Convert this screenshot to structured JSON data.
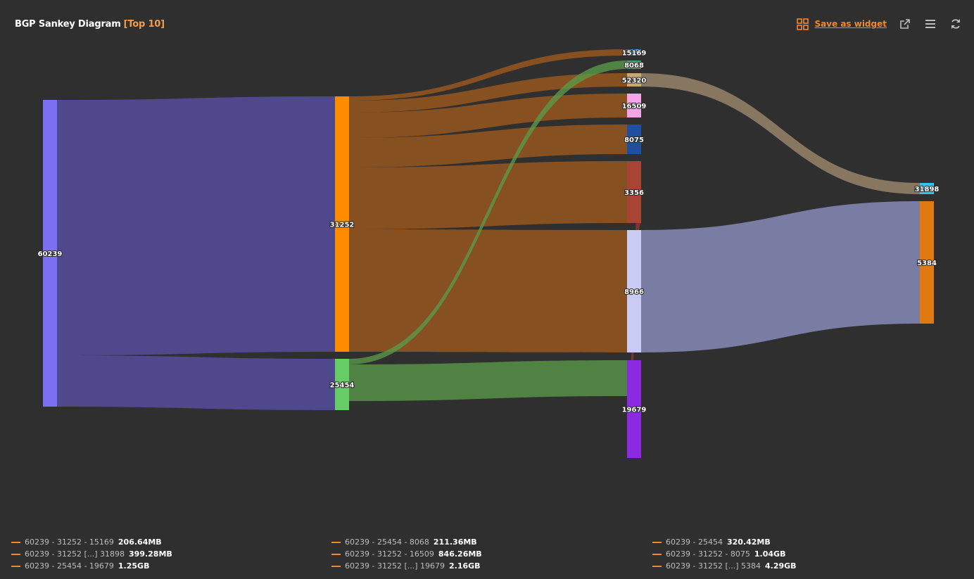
{
  "header": {
    "title": "BGP Sankey Diagram",
    "badge": "[Top 10]",
    "save_label": "Save as widget"
  },
  "colors": {
    "accent": "#f0892e",
    "background": "#2f2f2f"
  },
  "chart_data": {
    "type": "sankey",
    "title": "BGP Sankey Diagram",
    "nodes": [
      {
        "id": "60239",
        "color": "#7b6ff2"
      },
      {
        "id": "31252",
        "color": "#ff8c00"
      },
      {
        "id": "25454",
        "color": "#66cc66"
      },
      {
        "id": "15169",
        "color": "#5b9bd5"
      },
      {
        "id": "8068",
        "color": "#4d9f6a"
      },
      {
        "id": "52320",
        "color": "#c8a675"
      },
      {
        "id": "16509",
        "color": "#f7a3e8"
      },
      {
        "id": "8075",
        "color": "#1f4fa0"
      },
      {
        "id": "3356",
        "color": "#a84434"
      },
      {
        "id": "8966",
        "color": "#c9cbf5"
      },
      {
        "id": "19679",
        "color": "#8a2be2"
      },
      {
        "id": "31898",
        "color": "#2ec4f0"
      },
      {
        "id": "5384",
        "color": "#e07a10"
      }
    ],
    "links": [
      {
        "source": "60239",
        "target": "31252",
        "value": 8.0,
        "color": "#5a4fa8"
      },
      {
        "source": "60239",
        "target": "25454",
        "value": 1.7,
        "color": "#5a4fa8"
      },
      {
        "source": "31252",
        "target": "15169",
        "value": 0.2,
        "color": "#a05a1c"
      },
      {
        "source": "31252",
        "target": "52320",
        "value": 0.4,
        "color": "#a05a1c"
      },
      {
        "source": "31252",
        "target": "16509",
        "value": 0.8,
        "color": "#a05a1c"
      },
      {
        "source": "31252",
        "target": "8075",
        "value": 1.0,
        "color": "#a05a1c"
      },
      {
        "source": "31252",
        "target": "3356",
        "value": 2.0,
        "color": "#a05a1c"
      },
      {
        "source": "31252",
        "target": "8966",
        "value": 4.0,
        "color": "#a05a1c"
      },
      {
        "source": "25454",
        "target": "8068",
        "value": 0.2,
        "color": "#5a9a4a"
      },
      {
        "source": "25454",
        "target": "19679",
        "value": 1.2,
        "color": "#5a9a4a"
      },
      {
        "source": "3356",
        "target": "19679",
        "value": 0.9,
        "color": "#8c3a2e"
      },
      {
        "source": "52320",
        "target": "31898",
        "value": 0.4,
        "color": "#a08a6e"
      },
      {
        "source": "8966",
        "target": "5384",
        "value": 4.3,
        "color": "#8e93c4"
      }
    ],
    "legend": [
      [
        {
          "label": "60239 - 31252 - 15169",
          "value": "206.64MB"
        },
        {
          "label": "60239 - 31252 [...] 31898",
          "value": "399.28MB"
        },
        {
          "label": "60239 - 25454 - 19679",
          "value": "1.25GB"
        }
      ],
      [
        {
          "label": "60239 - 25454 - 8068",
          "value": "211.36MB"
        },
        {
          "label": "60239 - 31252 - 16509",
          "value": "846.26MB"
        },
        {
          "label": "60239 - 31252 [...] 19679",
          "value": "2.16GB"
        }
      ],
      [
        {
          "label": "60239 - 25454",
          "value": "320.42MB"
        },
        {
          "label": "60239 - 31252 - 8075",
          "value": "1.04GB"
        },
        {
          "label": "60239 - 31252 [...] 5384",
          "value": "4.29GB"
        }
      ]
    ]
  }
}
